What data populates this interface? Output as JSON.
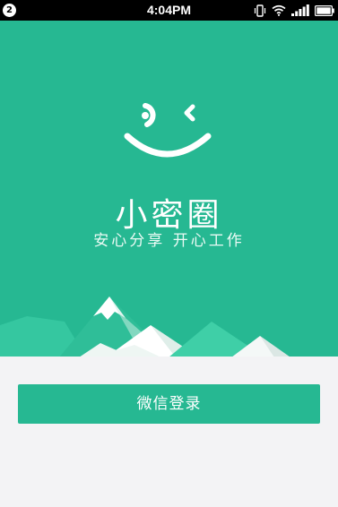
{
  "status_bar": {
    "notification_count": "2",
    "time": "4:04PM",
    "icons": [
      "vibrate-icon",
      "wifi-icon",
      "signal-icon",
      "battery-icon"
    ]
  },
  "hero": {
    "background_color": "#26b892",
    "logo_icon": "wink-face-icon",
    "app_name": "小密圈",
    "slogan": "安心分享  开心工作"
  },
  "actions": {
    "wechat_login_label": "微信登录"
  }
}
